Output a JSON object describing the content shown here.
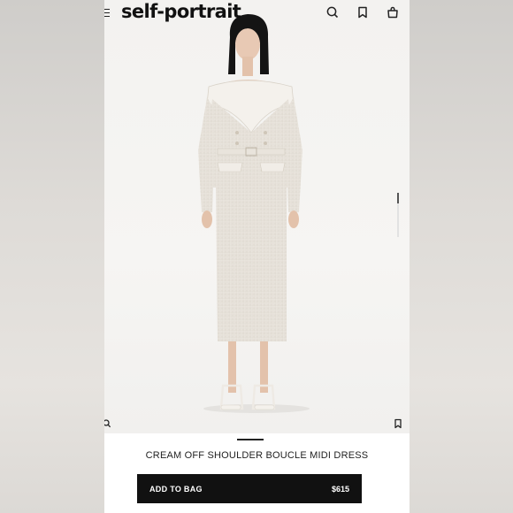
{
  "header": {
    "brand": "self-portrait",
    "icons": [
      "menu-icon",
      "search-icon",
      "bookmark-icon",
      "shopping-bag-icon"
    ]
  },
  "gallery": {
    "image_alt": "model-photo",
    "icons": [
      "zoom-icon",
      "wishlist-icon"
    ]
  },
  "product": {
    "name": "CREAM OFF SHOULDER BOUCLE MIDI DRESS",
    "add_to_bag_label": "ADD TO BAG",
    "price": "$615"
  },
  "colors": {
    "brand_text": "#111111",
    "button_bg": "#111111",
    "button_text": "#ffffff",
    "page_bg": "#ffffff",
    "outfit": "#ece8e1"
  }
}
